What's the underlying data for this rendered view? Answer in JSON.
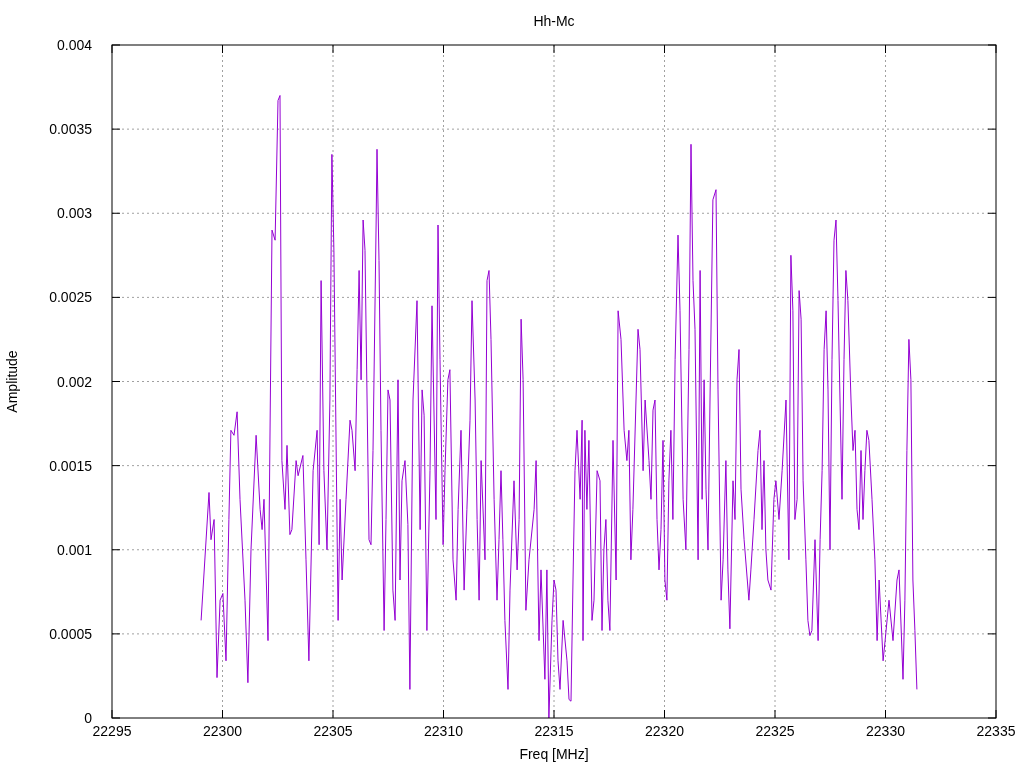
{
  "chart_data": {
    "type": "line",
    "grid": true,
    "title": "Hh-Mc",
    "xlabel": "Freq [MHz]",
    "ylabel": "Amplitude",
    "xlim": [
      22295,
      22335
    ],
    "ylim": [
      0,
      0.004
    ],
    "xticks": [
      22295,
      22300,
      22305,
      22310,
      22315,
      22320,
      22325,
      22330,
      22335
    ],
    "yticks": [
      0,
      0.0005,
      0.001,
      0.0015,
      0.002,
      0.0025,
      0.003,
      0.0035,
      0.004
    ],
    "x": [
      22299.03,
      22299.39,
      22299.48,
      22299.62,
      22299.75,
      22299.89,
      22300.02,
      22300.16,
      22300.29,
      22300.38,
      22300.52,
      22300.66,
      22300.79,
      22301.02,
      22301.15,
      22301.29,
      22301.52,
      22301.7,
      22301.79,
      22301.88,
      22302.06,
      22302.24,
      22302.38,
      22302.51,
      22302.6,
      22302.69,
      22302.83,
      22302.92,
      22303.05,
      22303.14,
      22303.33,
      22303.42,
      22303.64,
      22303.78,
      22303.91,
      22304.1,
      22304.28,
      22304.37,
      22304.46,
      22304.59,
      22304.73,
      22304.86,
      22304.95,
      22305.04,
      22305.23,
      22305.32,
      22305.41,
      22305.59,
      22305.77,
      22305.86,
      22306.0,
      22306.09,
      22306.18,
      22306.27,
      22306.36,
      22306.45,
      22306.63,
      22306.72,
      22306.81,
      22306.95,
      22306.99,
      22307.08,
      22307.17,
      22307.31,
      22307.4,
      22307.49,
      22307.58,
      22307.71,
      22307.81,
      22307.94,
      22308.03,
      22308.12,
      22308.26,
      22308.39,
      22308.48,
      22308.62,
      22308.8,
      22308.94,
      22309.03,
      22309.12,
      22309.25,
      22309.39,
      22309.48,
      22309.66,
      22309.75,
      22309.84,
      22309.98,
      22310.07,
      22310.2,
      22310.29,
      22310.43,
      22310.57,
      22310.66,
      22310.79,
      22310.93,
      22311.06,
      22311.2,
      22311.29,
      22311.43,
      22311.52,
      22311.61,
      22311.7,
      22311.88,
      22311.97,
      22312.06,
      22312.15,
      22312.29,
      22312.42,
      22312.51,
      22312.6,
      22312.69,
      22312.78,
      22312.92,
      22313.01,
      22313.19,
      22313.33,
      22313.42,
      22313.51,
      22313.6,
      22313.73,
      22313.87,
      22314.1,
      22314.19,
      22314.32,
      22314.41,
      22314.59,
      22314.68,
      22314.77,
      22314.91,
      22315.0,
      22315.09,
      22315.18,
      22315.27,
      22315.41,
      22315.59,
      22315.68,
      22315.77,
      22315.86,
      22315.95,
      22316.04,
      22316.18,
      22316.27,
      22316.31,
      22316.4,
      22316.49,
      22316.58,
      22316.72,
      22316.81,
      22316.95,
      22317.08,
      22317.17,
      22317.26,
      22317.35,
      22317.44,
      22317.53,
      22317.67,
      22317.81,
      22317.9,
      22318.03,
      22318.17,
      22318.3,
      22318.39,
      22318.48,
      22318.57,
      22318.8,
      22318.89,
      22319.03,
      22319.12,
      22319.3,
      22319.39,
      22319.48,
      22319.57,
      22319.66,
      22319.75,
      22319.84,
      22319.93,
      22320.02,
      22320.11,
      22320.2,
      22320.29,
      22320.38,
      22320.48,
      22320.61,
      22320.7,
      22320.84,
      22320.97,
      22321.11,
      22321.2,
      22321.29,
      22321.38,
      22321.52,
      22321.61,
      22321.7,
      22321.79,
      22321.88,
      22321.97,
      22322.06,
      22322.19,
      22322.33,
      22322.42,
      22322.56,
      22322.65,
      22322.78,
      22322.87,
      22322.96,
      22323.1,
      22323.19,
      22323.28,
      22323.37,
      22323.46,
      22323.6,
      22323.82,
      22323.91,
      22324.05,
      22324.23,
      22324.32,
      22324.41,
      22324.5,
      22324.59,
      22324.68,
      22324.82,
      22324.95,
      22325.04,
      22325.18,
      22325.32,
      22325.5,
      22325.63,
      22325.72,
      22325.81,
      22325.9,
      22326.0,
      22326.09,
      22326.18,
      22326.27,
      22326.4,
      22326.49,
      22326.58,
      22326.67,
      22326.81,
      22326.95,
      22327.04,
      22327.13,
      22327.22,
      22327.31,
      22327.4,
      22327.49,
      22327.58,
      22327.67,
      22327.76,
      22327.85,
      22327.94,
      22328.03,
      22328.12,
      22328.21,
      22328.3,
      22328.44,
      22328.53,
      22328.62,
      22328.71,
      22328.8,
      22328.89,
      22328.98,
      22329.07,
      22329.16,
      22329.25,
      22329.39,
      22329.52,
      22329.62,
      22329.71,
      22329.89,
      22329.98,
      22330.16,
      22330.34,
      22330.52,
      22330.61,
      22330.79,
      22330.88,
      22330.97,
      22331.06,
      22331.15,
      22331.24,
      22331.33,
      22331.42
    ],
    "series": [
      {
        "color": "#9400d3",
        "values": [
          0.00058,
          0.00134,
          0.00106,
          0.00118,
          0.00024,
          0.0007,
          0.00074,
          0.00034,
          0.00118,
          0.00171,
          0.00168,
          0.00182,
          0.0013,
          0.0007,
          0.00021,
          0.001,
          0.00168,
          0.00124,
          0.00112,
          0.0013,
          0.00046,
          0.0029,
          0.00284,
          0.00367,
          0.0037,
          0.00153,
          0.00124,
          0.00162,
          0.00109,
          0.00112,
          0.00153,
          0.00144,
          0.00156,
          0.00094,
          0.00034,
          0.00147,
          0.00171,
          0.00103,
          0.0026,
          0.00147,
          0.001,
          0.00189,
          0.00335,
          0.00278,
          0.00058,
          0.0013,
          0.00082,
          0.0013,
          0.00177,
          0.00171,
          0.00147,
          0.00207,
          0.00266,
          0.00201,
          0.00296,
          0.00278,
          0.00106,
          0.00103,
          0.00159,
          0.00293,
          0.00338,
          0.00272,
          0.00171,
          0.00052,
          0.00118,
          0.00195,
          0.00189,
          0.00076,
          0.00058,
          0.00201,
          0.00082,
          0.00141,
          0.00153,
          0.00115,
          0.00017,
          0.00189,
          0.00248,
          0.00112,
          0.00195,
          0.0018,
          0.00052,
          0.00147,
          0.00245,
          0.00118,
          0.00293,
          0.00213,
          0.00103,
          0.00147,
          0.00201,
          0.00207,
          0.00094,
          0.0007,
          0.00124,
          0.00171,
          0.00076,
          0.00124,
          0.00177,
          0.00248,
          0.00189,
          0.00118,
          0.0007,
          0.00153,
          0.00094,
          0.0026,
          0.00266,
          0.00225,
          0.0013,
          0.0007,
          0.00106,
          0.00147,
          0.00106,
          0.00058,
          0.00017,
          0.00076,
          0.00141,
          0.00088,
          0.00118,
          0.00237,
          0.00201,
          0.00064,
          0.00094,
          0.00124,
          0.00153,
          0.00046,
          0.00088,
          0.00023,
          0.00088,
          0,
          0.00058,
          0.00082,
          0.00076,
          0.00034,
          0.00017,
          0.00058,
          0.00034,
          0.00011,
          0.0001,
          0.00082,
          0.00147,
          0.00171,
          0.0013,
          0.00177,
          0.00046,
          0.00171,
          0.00124,
          0.00165,
          0.00058,
          0.0007,
          0.00147,
          0.00141,
          0.00052,
          0.001,
          0.00118,
          0.0007,
          0.00052,
          0.00165,
          0.00082,
          0.00242,
          0.00225,
          0.00171,
          0.00153,
          0.00171,
          0.00094,
          0.00124,
          0.00231,
          0.00219,
          0.00147,
          0.00189,
          0.00153,
          0.0013,
          0.00183,
          0.00189,
          0.00118,
          0.00088,
          0.00112,
          0.00165,
          0.00082,
          0.0007,
          0.00141,
          0.00171,
          0.00118,
          0.00213,
          0.00287,
          0.00242,
          0.0013,
          0.001,
          0.00219,
          0.00341,
          0.0026,
          0.00231,
          0.00094,
          0.00266,
          0.0013,
          0.00201,
          0.00136,
          0.001,
          0.00189,
          0.00308,
          0.00314,
          0.00195,
          0.0007,
          0.00094,
          0.00153,
          0.00088,
          0.00053,
          0.00141,
          0.00118,
          0.00201,
          0.00219,
          0.00136,
          0.00106,
          0.0007,
          0.00088,
          0.00118,
          0.00159,
          0.00171,
          0.00112,
          0.00153,
          0.001,
          0.00082,
          0.00076,
          0.0013,
          0.00141,
          0.00118,
          0.00147,
          0.00189,
          0.00094,
          0.00275,
          0.00242,
          0.00118,
          0.0013,
          0.00254,
          0.00237,
          0.00141,
          0.00094,
          0.00058,
          0.00049,
          0.00052,
          0.00106,
          0.00046,
          0.00106,
          0.00147,
          0.00219,
          0.00242,
          0.00195,
          0.001,
          0.00213,
          0.00284,
          0.00296,
          0.00248,
          0.00189,
          0.0013,
          0.00213,
          0.00266,
          0.00248,
          0.00189,
          0.00159,
          0.00171,
          0.00124,
          0.00112,
          0.00159,
          0.00118,
          0.00147,
          0.00171,
          0.00165,
          0.0013,
          0.00094,
          0.00046,
          0.00082,
          0.00034,
          0.00046,
          0.0007,
          0.00046,
          0.00082,
          0.00088,
          0.00023,
          0.0007,
          0.00159,
          0.00225,
          0.00201,
          0.00082,
          0.00052,
          0.00017
        ]
      }
    ]
  }
}
